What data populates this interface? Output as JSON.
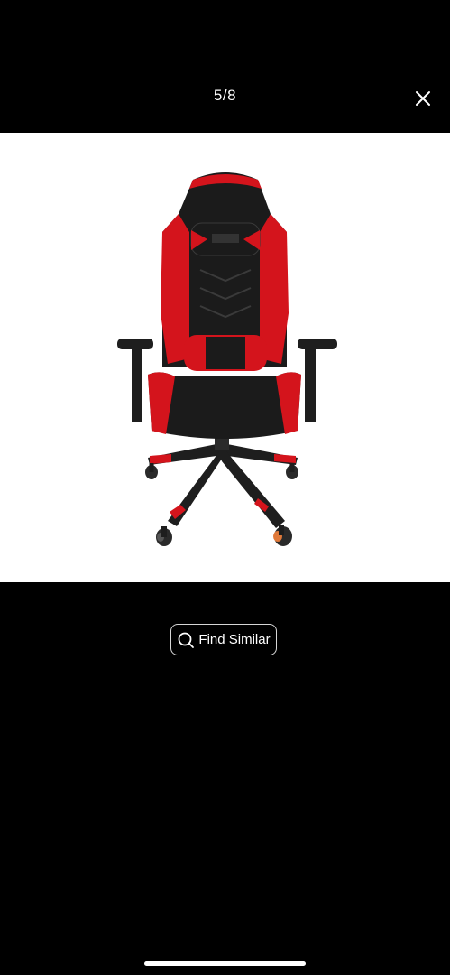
{
  "viewer": {
    "counter": "5/8",
    "close_icon": "close-icon"
  },
  "image": {
    "subject": "gaming-chair",
    "colors": {
      "primary": "#1b1b1b",
      "accent": "#d4141c"
    }
  },
  "actions": {
    "find_similar_label": "Find Similar",
    "find_similar_icon": "search-icon"
  },
  "colors": {
    "background": "#000000",
    "image_background": "#ffffff",
    "text": "#ffffff"
  }
}
